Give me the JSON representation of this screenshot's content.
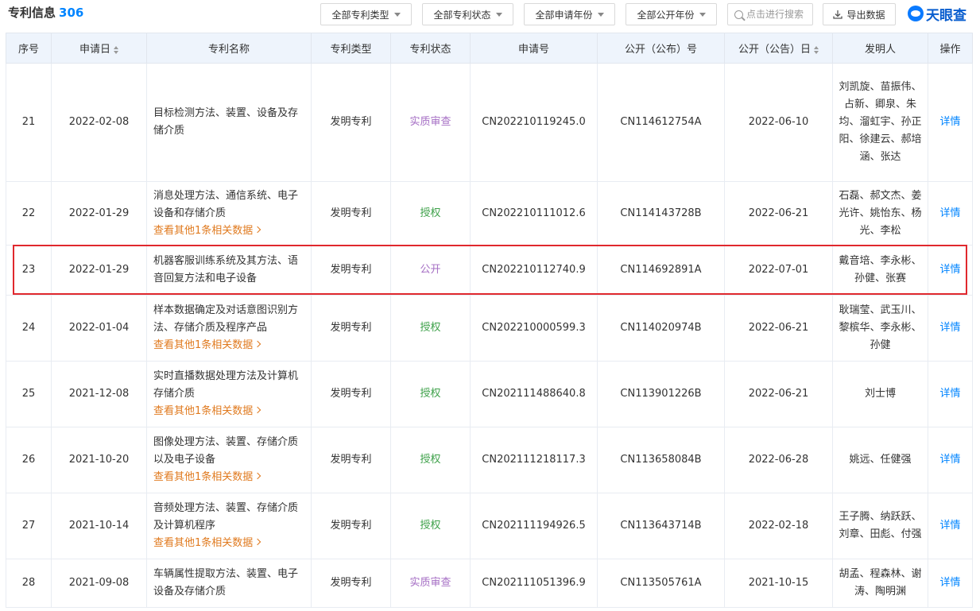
{
  "header": {
    "title": "专利信息",
    "count": "306"
  },
  "filters": [
    {
      "label": "全部专利类型"
    },
    {
      "label": "全部专利状态"
    },
    {
      "label": "全部申请年份"
    },
    {
      "label": "全部公开年份"
    }
  ],
  "search": {
    "placeholder": "点击进行搜索"
  },
  "export_label": "导出数据",
  "logo_text": "天眼查",
  "columns": {
    "seq": "序号",
    "apply_date": "申请日",
    "name": "专利名称",
    "type": "专利类型",
    "status": "专利状态",
    "app_no": "申请号",
    "pub_no": "公开（公布）号",
    "pub_date": "公开（公告）日",
    "inventor": "发明人",
    "action": "操作"
  },
  "more_label": "查看其他1条相关数据",
  "detail_label": "详情",
  "rows": [
    {
      "seq": "21",
      "apply_date": "2022-02-08",
      "name": "目标检测方法、装置、设备及存储介质",
      "more": false,
      "type": "发明专利",
      "status": "实质审查",
      "status_class": "status-shenzhi",
      "app_no": "CN202210119245.0",
      "pub_no": "CN114612754A",
      "pub_date": "2022-06-10",
      "inventor": "刘凯旋、苗振伟、占新、卿泉、朱均、溜虹宇、孙正阳、徐建云、郝培涵、张达"
    },
    {
      "seq": "22",
      "apply_date": "2022-01-29",
      "name": "消息处理方法、通信系统、电子设备和存储介质",
      "more": true,
      "type": "发明专利",
      "status": "授权",
      "status_class": "status-shouquan",
      "app_no": "CN202210111012.6",
      "pub_no": "CN114143728B",
      "pub_date": "2022-06-21",
      "inventor": "石磊、郝文杰、姜光许、姚怡东、杨光、李松"
    },
    {
      "seq": "23",
      "apply_date": "2022-01-29",
      "name": "机器客服训练系统及其方法、语音回复方法和电子设备",
      "more": false,
      "type": "发明专利",
      "status": "公开",
      "status_class": "status-gongkai",
      "app_no": "CN202210112740.9",
      "pub_no": "CN114692891A",
      "pub_date": "2022-07-01",
      "inventor": "戴音培、李永彬、孙健、张赛"
    },
    {
      "seq": "24",
      "apply_date": "2022-01-04",
      "name": "样本数据确定及对话意图识别方法、存储介质及程序产品",
      "more": true,
      "type": "发明专利",
      "status": "授权",
      "status_class": "status-shouquan",
      "app_no": "CN202210000599.3",
      "pub_no": "CN114020974B",
      "pub_date": "2022-06-21",
      "inventor": "耿瑞莹、武玉川、黎槟华、李永彬、孙健"
    },
    {
      "seq": "25",
      "apply_date": "2021-12-08",
      "name": "实时直播数据处理方法及计算机存储介质",
      "more": true,
      "type": "发明专利",
      "status": "授权",
      "status_class": "status-shouquan",
      "app_no": "CN202111488640.8",
      "pub_no": "CN113901226B",
      "pub_date": "2022-06-21",
      "inventor": "刘士博"
    },
    {
      "seq": "26",
      "apply_date": "2021-10-20",
      "name": "图像处理方法、装置、存储介质以及电子设备",
      "more": true,
      "type": "发明专利",
      "status": "授权",
      "status_class": "status-shouquan",
      "app_no": "CN202111218117.3",
      "pub_no": "CN113658084B",
      "pub_date": "2022-06-28",
      "inventor": "姚远、任健强"
    },
    {
      "seq": "27",
      "apply_date": "2021-10-14",
      "name": "音频处理方法、装置、存储介质及计算机程序",
      "more": true,
      "type": "发明专利",
      "status": "授权",
      "status_class": "status-shouquan",
      "app_no": "CN202111194926.5",
      "pub_no": "CN113643714B",
      "pub_date": "2022-02-18",
      "inventor": "王子腾、纳跃跃、刘章、田彪、付强"
    },
    {
      "seq": "28",
      "apply_date": "2021-09-08",
      "name": "车辆属性提取方法、装置、电子设备及存储介质",
      "more": false,
      "type": "发明专利",
      "status": "实质审查",
      "status_class": "status-shenzhi",
      "app_no": "CN202111051396.9",
      "pub_no": "CN113505761A",
      "pub_date": "2021-10-15",
      "inventor": "胡孟、程森林、谢涛、陶明渊"
    }
  ]
}
